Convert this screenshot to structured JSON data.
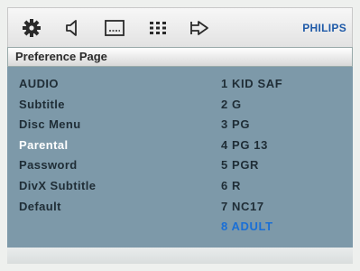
{
  "toolbar": {
    "icons": [
      "gear-icon",
      "speaker-icon",
      "subtitle-icon",
      "grid-icon",
      "arrow-right-icon"
    ],
    "brand": "PHILIPS"
  },
  "page_title": "Preference Page",
  "menu": [
    {
      "label": "AUDIO"
    },
    {
      "label": "Subtitle"
    },
    {
      "label": "Disc Menu"
    },
    {
      "label": "Parental",
      "active": true
    },
    {
      "label": "Password"
    },
    {
      "label": "DivX Subtitle"
    },
    {
      "label": "Default"
    }
  ],
  "parental_options": [
    {
      "label": "1 KID SAF"
    },
    {
      "label": "2 G"
    },
    {
      "label": "3 PG"
    },
    {
      "label": "4 PG 13"
    },
    {
      "label": "5 PGR"
    },
    {
      "label": "6 R"
    },
    {
      "label": "7 NC17"
    },
    {
      "label": "8 ADULT",
      "selected": true
    }
  ],
  "colors": {
    "panel": "#7d99a9",
    "text": "#1f2d36",
    "active_text": "#ffffff",
    "selected_text": "#1a6fd6",
    "brand": "#1f5aa8"
  }
}
